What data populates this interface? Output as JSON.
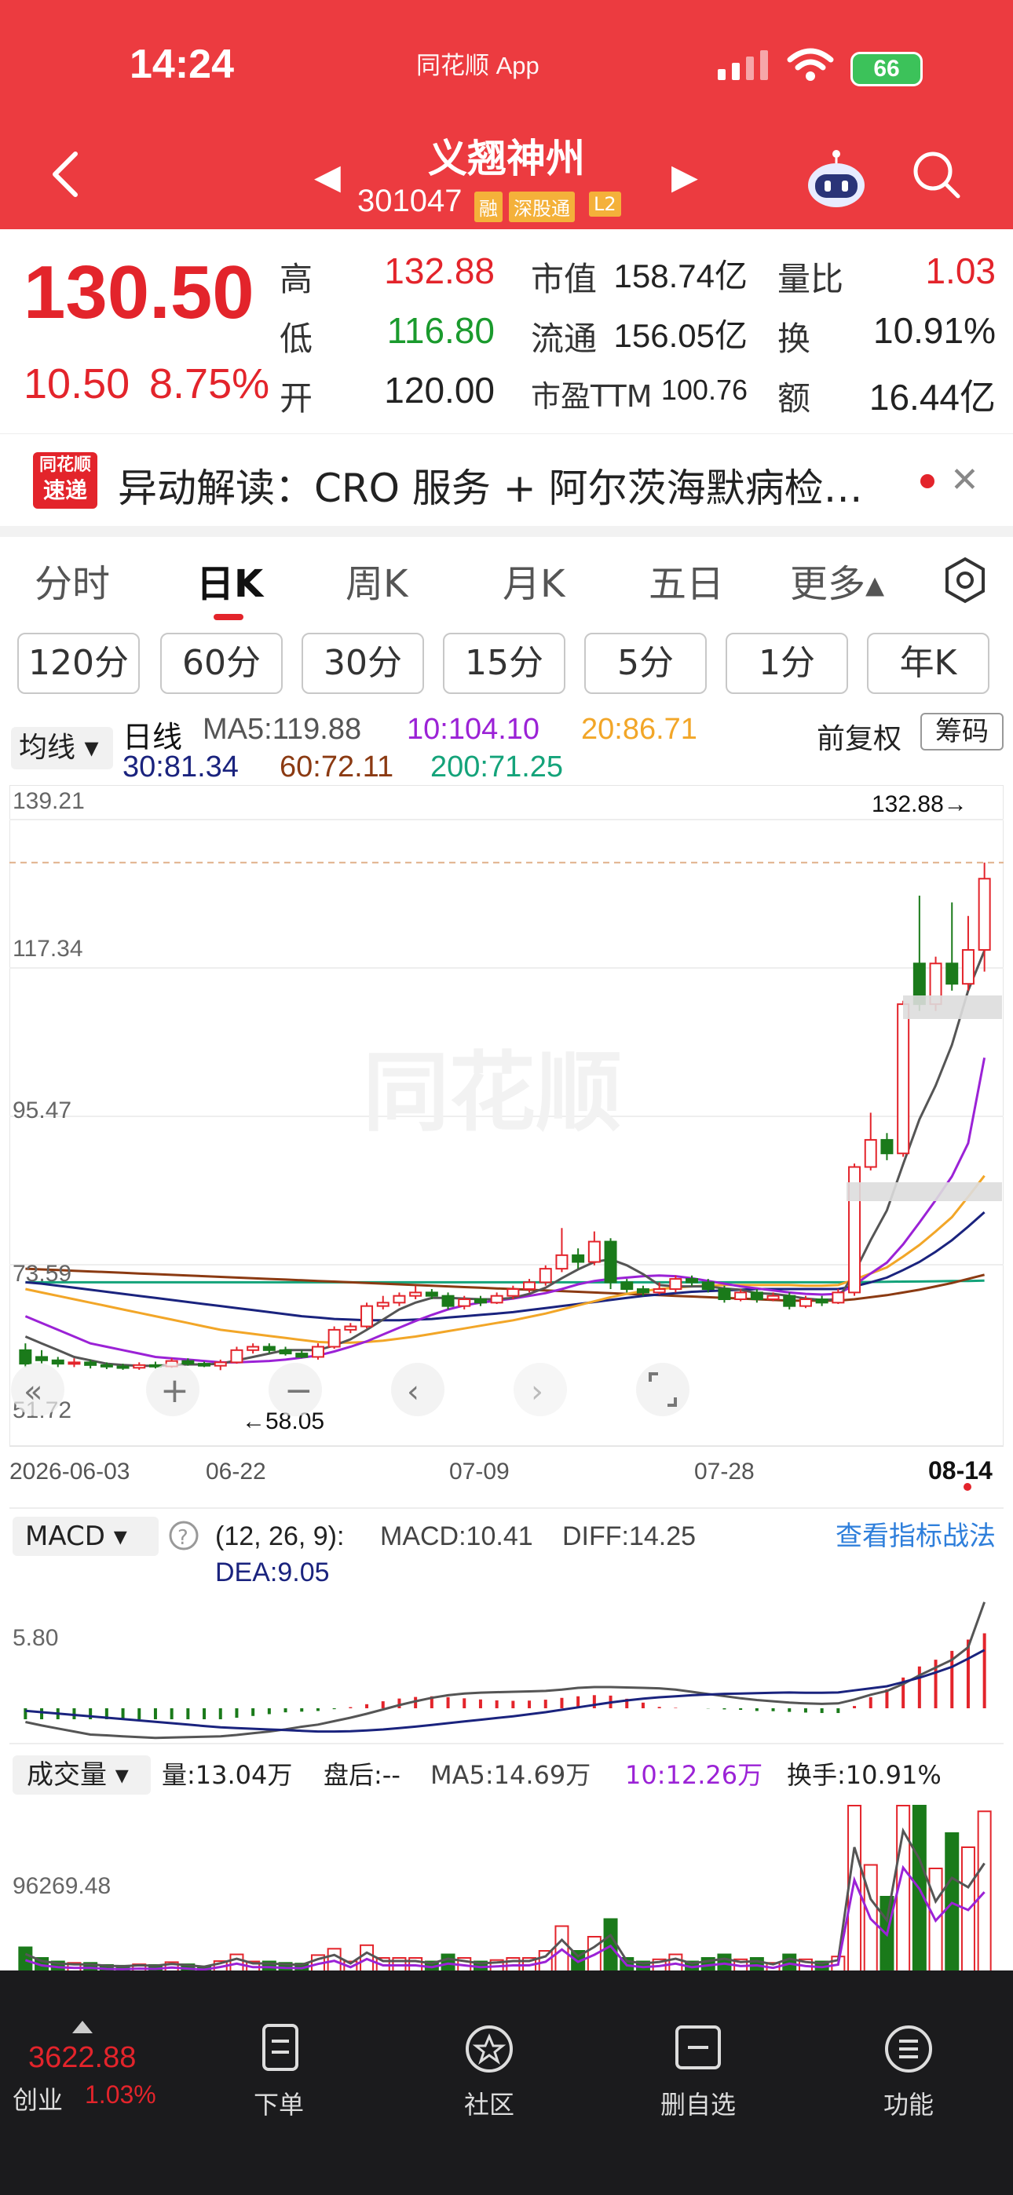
{
  "status_bar": {
    "time": "14:24",
    "app_name": "同花顺 App",
    "battery": "66"
  },
  "header": {
    "stock_name": "义翘神州",
    "stock_code": "301047",
    "tags": [
      "融",
      "深股通",
      "L2"
    ]
  },
  "quote": {
    "price": "130.50",
    "change": "10.50",
    "change_pct": "8.75%",
    "high_label": "高",
    "high": "132.88",
    "low_label": "低",
    "low": "116.80",
    "open_label": "开",
    "open": "120.00",
    "mcap_label": "市值",
    "mcap": "158.74亿",
    "float_label": "流通",
    "float": "156.05亿",
    "pe_label": "市盈TTM",
    "pe": "100.76",
    "vr_label": "量比",
    "vr": "1.03",
    "turn_label": "换",
    "turn": "10.91%",
    "amt_label": "额",
    "amt": "16.44亿"
  },
  "news": {
    "logo_top": "同花顺",
    "logo_bottom": "速递",
    "text": "异动解读：CRO 服务 + 阿尔茨海默病检…"
  },
  "tabs": [
    "分时",
    "日K",
    "周K",
    "月K",
    "五日",
    "更多▴"
  ],
  "periods": [
    "120分",
    "60分",
    "30分",
    "15分",
    "5分",
    "1分",
    "年K"
  ],
  "legend": {
    "ma_select": "均线 ▾",
    "line_type": "日线",
    "ma5": "MA5:119.88",
    "ma10": "10:104.10",
    "ma20": "20:86.71",
    "ma30": "30:81.34",
    "ma60": "60:72.11",
    "ma200": "200:71.25",
    "adjust": "前复权",
    "chip": "筹码"
  },
  "colors": {
    "up": "#e3242b",
    "down": "#1a7a1a",
    "ma5": "#555555",
    "ma10": "#9b22d6",
    "ma20": "#f2a628",
    "ma30": "#1a237e",
    "ma60": "#8b3a12",
    "ma200": "#14a37a"
  },
  "chart_data": {
    "type": "candlestick",
    "price_axis_labels": [
      "139.21",
      "117.34",
      "95.47",
      "73.59",
      "51.72"
    ],
    "date_labels": [
      "2026-06-03",
      "06-22",
      "07-09",
      "07-28",
      "08-14"
    ],
    "high_marker": "132.88→",
    "low_marker": "←58.05",
    "watermark": "同花顺",
    "candles": [
      [
        61,
        59,
        62,
        58.5
      ],
      [
        60,
        59.5,
        61,
        59
      ],
      [
        59.5,
        59,
        60,
        58.5
      ],
      [
        59,
        59.2,
        59.8,
        58.5
      ],
      [
        59.2,
        58.8,
        59.6,
        58.3
      ],
      [
        58.8,
        58.6,
        59.2,
        58.2
      ],
      [
        58.6,
        58.4,
        59,
        58.1
      ],
      [
        58.4,
        58.8,
        59.2,
        58.1
      ],
      [
        58.8,
        58.6,
        59.3,
        58.3
      ],
      [
        58.6,
        59.4,
        59.8,
        58.4
      ],
      [
        59.4,
        59,
        59.8,
        58.7
      ],
      [
        59,
        58.7,
        59.3,
        58.5
      ],
      [
        58.7,
        59.2,
        59.6,
        58.05
      ],
      [
        59.2,
        61,
        61.5,
        59
      ],
      [
        61,
        61.5,
        62,
        60.5
      ],
      [
        61.5,
        61,
        62,
        60.5
      ],
      [
        61,
        60.5,
        61.5,
        60.2
      ],
      [
        60.5,
        60,
        61,
        59.8
      ],
      [
        60,
        61.5,
        62,
        59.6
      ],
      [
        61.5,
        64,
        64.5,
        61.2
      ],
      [
        64,
        64.5,
        65,
        63.5
      ],
      [
        64.5,
        67.5,
        68,
        64.2
      ],
      [
        67.5,
        68,
        69,
        67
      ],
      [
        68,
        69,
        69.5,
        67.5
      ],
      [
        69,
        69.5,
        70.5,
        68.5
      ],
      [
        69.5,
        69,
        70,
        68.5
      ],
      [
        69,
        67.5,
        69.5,
        67
      ],
      [
        67.5,
        68.5,
        69,
        67
      ],
      [
        68.5,
        68,
        69,
        67.5
      ],
      [
        68,
        69,
        69.5,
        67.8
      ],
      [
        69,
        70,
        70.5,
        68.5
      ],
      [
        70,
        71,
        71.5,
        69.5
      ],
      [
        71,
        73,
        73.5,
        70.5
      ],
      [
        73,
        75,
        79,
        72.5
      ],
      [
        75,
        74,
        76,
        73
      ],
      [
        74,
        77,
        78.5,
        73.5
      ],
      [
        77,
        71,
        77.5,
        70
      ],
      [
        71,
        70,
        71.5,
        69.5
      ],
      [
        70,
        69.5,
        70.5,
        69
      ],
      [
        69.5,
        70,
        71,
        69.2
      ],
      [
        70,
        71.5,
        72,
        69.5
      ],
      [
        71.5,
        71,
        72,
        70.5
      ],
      [
        71,
        70,
        71.5,
        69.5
      ],
      [
        70,
        68.5,
        70.5,
        68
      ],
      [
        68.5,
        69.5,
        70,
        68.2
      ],
      [
        69.5,
        68.5,
        70,
        68
      ],
      [
        68.5,
        69,
        69.5,
        68.2
      ],
      [
        69,
        67.5,
        69.5,
        67
      ],
      [
        67.5,
        68.5,
        69,
        67.2
      ],
      [
        68.5,
        68,
        69,
        67.5
      ],
      [
        68,
        69.5,
        70,
        67.8
      ],
      [
        69.5,
        88,
        88.5,
        69
      ],
      [
        88,
        92,
        96,
        87.5
      ],
      [
        92,
        90,
        93,
        89
      ],
      [
        90,
        112,
        112.5,
        89.5
      ],
      [
        118,
        112,
        128,
        111
      ],
      [
        112,
        118,
        119,
        111
      ],
      [
        118,
        115,
        127,
        114
      ],
      [
        115,
        120,
        125,
        114
      ],
      [
        120,
        130.5,
        132.88,
        116.8
      ]
    ],
    "ma5": [
      63,
      62,
      61,
      60,
      59.5,
      59,
      58.8,
      58.7,
      58.7,
      58.8,
      58.9,
      58.9,
      59,
      59.5,
      60,
      60.5,
      61,
      61,
      61,
      61.7,
      62.6,
      64,
      65.5,
      67,
      68,
      68.7,
      68.7,
      68.6,
      68.5,
      68.5,
      68.7,
      69.3,
      70.2,
      71.6,
      72.9,
      74,
      74.4,
      73.5,
      72.2,
      70.6,
      70.4,
      70.4,
      70.4,
      70.1,
      69.9,
      69.4,
      69.3,
      69,
      68.6,
      68.4,
      68.5,
      72.4,
      77.2,
      81.6,
      88.4,
      95,
      100,
      106,
      114,
      119.88
    ],
    "ma10": [
      66,
      65,
      64,
      63,
      62,
      61.5,
      61,
      60.5,
      60,
      59.8,
      59.6,
      59.4,
      59.2,
      59.2,
      59.3,
      59.4,
      59.6,
      59.9,
      60.2,
      60.8,
      61.5,
      62.3,
      63.3,
      64.3,
      65.3,
      66.2,
      67,
      67.6,
      68,
      68.3,
      68.6,
      69,
      69.4,
      70,
      70.7,
      71.2,
      71.5,
      71.7,
      71.9,
      72,
      71.9,
      71.6,
      71.2,
      70.8,
      70.4,
      70.1,
      69.8,
      69.5,
      69.3,
      69.2,
      69.3,
      70.6,
      72.3,
      73.9,
      76.6,
      79.8,
      83.1,
      86.6,
      91.5,
      104.1
    ],
    "ma20": [
      70,
      69.5,
      69,
      68.5,
      68,
      67.5,
      67,
      66.5,
      66,
      65.5,
      65,
      64.5,
      64,
      63.7,
      63.4,
      63.1,
      62.8,
      62.5,
      62.2,
      62.1,
      62.1,
      62.2,
      62.4,
      62.7,
      63,
      63.4,
      63.8,
      64.2,
      64.6,
      65,
      65.4,
      65.9,
      66.4,
      67,
      67.6,
      68.2,
      68.8,
      69.3,
      69.7,
      70,
      70.2,
      70.4,
      70.5,
      70.6,
      70.6,
      70.6,
      70.6,
      70.6,
      70.5,
      70.5,
      70.6,
      71.4,
      72.3,
      73.2,
      74.8,
      76.5,
      78.5,
      80.6,
      83.6,
      86.71
    ],
    "ma30": [
      71,
      70.8,
      70.5,
      70.2,
      69.9,
      69.6,
      69.3,
      69,
      68.7,
      68.4,
      68.1,
      67.8,
      67.5,
      67.2,
      66.9,
      66.6,
      66.3,
      66,
      65.8,
      65.6,
      65.5,
      65.4,
      65.4,
      65.4,
      65.5,
      65.6,
      65.8,
      66,
      66.2,
      66.4,
      66.6,
      66.9,
      67.2,
      67.5,
      67.8,
      68.1,
      68.4,
      68.7,
      69,
      69.2,
      69.4,
      69.6,
      69.7,
      69.8,
      69.9,
      70,
      70,
      70,
      70,
      70,
      70,
      70.4,
      71,
      71.7,
      72.8,
      74,
      75.5,
      77.2,
      79.2,
      81.34
    ],
    "ma60": [
      73,
      72.9,
      72.8,
      72.7,
      72.6,
      72.5,
      72.4,
      72.3,
      72.2,
      72.1,
      72,
      71.9,
      71.8,
      71.7,
      71.6,
      71.5,
      71.4,
      71.3,
      71.2,
      71.1,
      71,
      70.9,
      70.8,
      70.7,
      70.6,
      70.5,
      70.4,
      70.3,
      70.2,
      70.1,
      70,
      69.9,
      69.8,
      69.7,
      69.6,
      69.5,
      69.4,
      69.3,
      69.2,
      69.1,
      69,
      68.9,
      68.8,
      68.7,
      68.6,
      68.5,
      68.4,
      68.3,
      68.3,
      68.3,
      68.3,
      68.5,
      68.8,
      69.1,
      69.5,
      69.9,
      70.4,
      70.9,
      71.5,
      72.11
    ],
    "ma200": [
      71,
      71,
      71,
      71,
      71,
      71,
      71,
      71,
      71,
      71,
      71,
      71,
      71,
      71,
      71,
      71,
      71,
      71,
      71,
      71,
      71,
      71,
      71,
      71,
      71,
      71,
      71,
      71,
      71,
      71,
      71,
      71,
      71,
      71,
      71,
      71,
      71,
      71,
      71,
      71,
      71,
      71,
      71,
      71,
      71,
      71,
      71,
      71,
      71,
      71,
      71,
      71,
      71.05,
      71.08,
      71.1,
      71.12,
      71.15,
      71.18,
      71.2,
      71.25
    ]
  },
  "macd": {
    "select": "MACD ▾",
    "params": "(12, 26, 9):",
    "macd": "MACD:10.41",
    "diff": "DIFF:14.25",
    "dea": "DEA:9.05",
    "link": "查看指标战法",
    "axis_label": "5.80"
  },
  "volume": {
    "select": "成交量 ▾",
    "vol": "量:13.04万",
    "after": "盘后:--",
    "ma5": "MA5:14.69万",
    "ma10": "10:12.26万",
    "turnover": "换手:10.91%",
    "axis_label": "96269.48"
  },
  "bottom_bar": {
    "index_value": "3622.88",
    "index_name": "创业",
    "index_pct": "1.03%",
    "items": [
      "下单",
      "社区",
      "删自选",
      "功能"
    ]
  }
}
